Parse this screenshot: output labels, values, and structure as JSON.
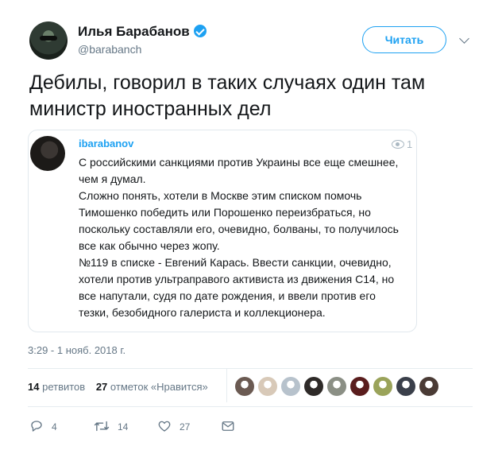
{
  "author": {
    "name": "Илья Барабанов",
    "handle": "@barabanch",
    "verified": true
  },
  "follow_button": "Читать",
  "tweet": {
    "text_lines": [
      "Дебилы, говорил в таких случаях один там",
      "министр иностранных дел"
    ]
  },
  "quoted": {
    "username": "ibarabanov",
    "views": "1",
    "lines": [
      "С российскими санкциями против Украины все еще смешнее,",
      "чем я думал.",
      "Сложно понять, хотели в Москве этим списком помочь",
      "Тимошенко победить или Порошенко переизбраться, но",
      "поскольку составляли его, очевидно, болваны, то получилось",
      "все как обычно через жопу.",
      "№119 в списке - Евгений Карась. Ввести санкции, очевидно,",
      "хотели против ультраправого активиста из движения С14, но",
      "все напутали, судя по дате рождения, и ввели против его",
      "тезки, безобидного галериста и коллекционера."
    ]
  },
  "timestamp": "3:29 - 1 нояб. 2018 г.",
  "stats": {
    "retweets_count": "14",
    "retweets_label": "ретвитов",
    "likes_count": "27",
    "likes_label": "отметок «Нравится»"
  },
  "liker_avatars": [
    "#6b5a52",
    "#d8c9b8",
    "#b7c2cc",
    "#2e2a28",
    "#8b8f85",
    "#5a1d1d",
    "#9aa35a",
    "#3a3f4a",
    "#4a3b35",
    "#c9c9c9"
  ],
  "actions": {
    "replies": "4",
    "retweets": "14",
    "likes": "27"
  },
  "colors": {
    "accent": "#1da1f2",
    "muted": "#657786",
    "border": "#e1e8ed"
  }
}
